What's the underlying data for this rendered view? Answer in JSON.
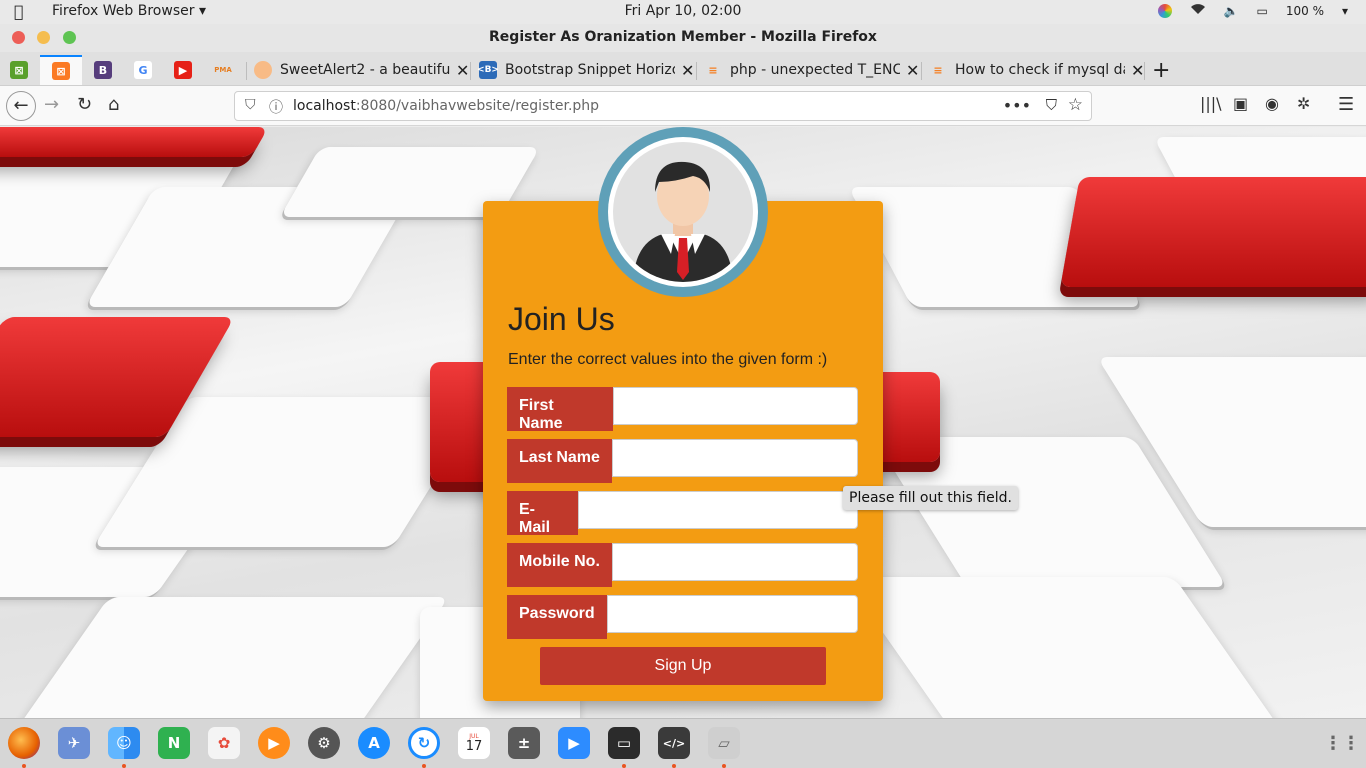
{
  "system": {
    "app_name": "Firefox Web Browser",
    "clock": "Fri Apr 10, 02:00",
    "battery": "100 %"
  },
  "window": {
    "title": "Register As Oranization Member - Mozilla Firefox"
  },
  "tabs": [
    {
      "label": "SweetAlert2 - a beautiful"
    },
    {
      "label": "Bootstrap Snippet Horizo"
    },
    {
      "label": "php - unexpected T_ENC"
    },
    {
      "label": "How to check if mysql da"
    }
  ],
  "pinned_tab_letters": {
    "bootstrap": "B",
    "google": "G",
    "pma": "PMA"
  },
  "url": {
    "host": "localhost",
    "path": ":8080/vaibhavwebsite/register.php"
  },
  "form": {
    "heading": "Join Us",
    "lead": "Enter the correct values into the given form :)",
    "fields": [
      {
        "label": "First Name",
        "value": ""
      },
      {
        "label": "Last Name",
        "value": ""
      },
      {
        "label": "E-Mail",
        "value": ""
      },
      {
        "label": "Mobile No.",
        "value": ""
      },
      {
        "label": "Password",
        "value": ""
      }
    ],
    "submit": "Sign Up",
    "tooltip": "Please fill out this field."
  },
  "dock": {
    "notes_letter": "N",
    "calendar_month": "JUL",
    "calendar_day": "17"
  },
  "colors": {
    "card": "#f39c12",
    "accent": "#c0392b",
    "avatar_ring": "#5fa0b8"
  }
}
